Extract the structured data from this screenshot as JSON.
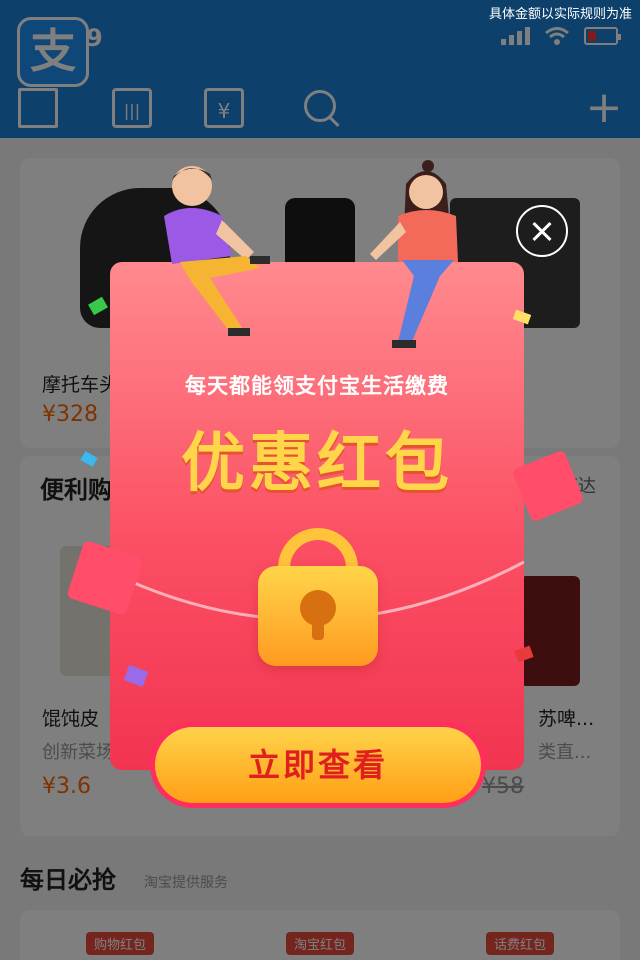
{
  "disclaimer": "具体金额以实际规则为准",
  "status_bar": {
    "time": "9"
  },
  "app_logo": "支",
  "toolbar": {
    "pay_glyph": "|||",
    "collect_glyph": "¥",
    "add_glyph": "+"
  },
  "products_top": [
    {
      "name": "摩托车头",
      "price": "¥328"
    }
  ],
  "convenience": {
    "title": "便利购",
    "right_label": "速达"
  },
  "products_mid": [
    {
      "name": "馄饨皮",
      "sub": "创新菜场",
      "price": "¥3.6"
    },
    {
      "name": "苏啤...",
      "sub": "类直...",
      "price": "¥58"
    }
  ],
  "daily": {
    "title": "每日必抢",
    "subtitle": "淘宝提供服务",
    "tags": [
      "购物红包",
      "淘宝红包",
      "话费红包"
    ]
  },
  "modal": {
    "subtitle": "每天都能领支付宝生活缴费",
    "title": "优惠红包",
    "button": "立即查看"
  },
  "colors": {
    "brand_blue": "#1a82d9",
    "envelope_top": "#ff8a8e",
    "envelope_bottom": "#f23451",
    "gold": "#ffd64a",
    "button_text": "#e0201e"
  },
  "icons": [
    "scan-icon",
    "pay-code-icon",
    "collect-icon",
    "search-icon",
    "add-icon",
    "close-icon",
    "lock-icon",
    "battery-icon",
    "wifi-icon",
    "signal-icon"
  ]
}
